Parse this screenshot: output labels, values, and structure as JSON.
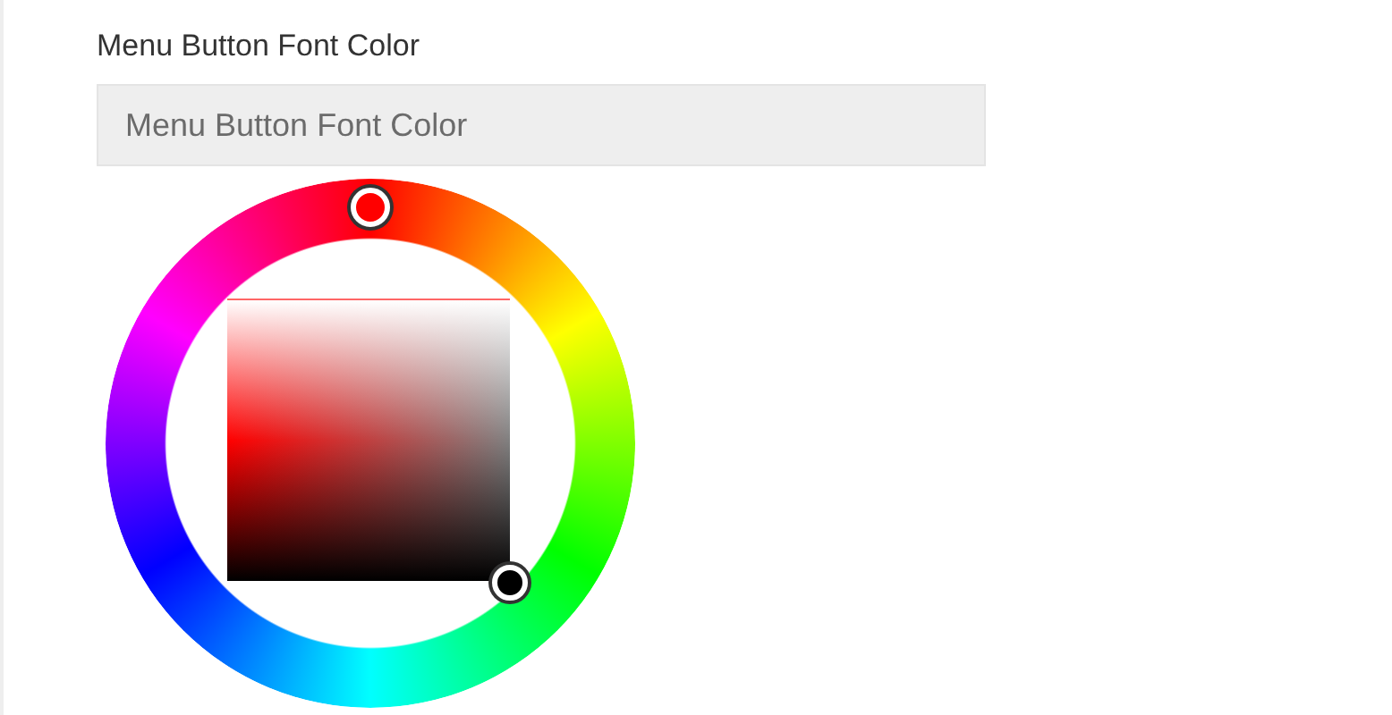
{
  "field": {
    "label": "Menu Button Font Color",
    "placeholder": "Menu Button Font Color"
  }
}
